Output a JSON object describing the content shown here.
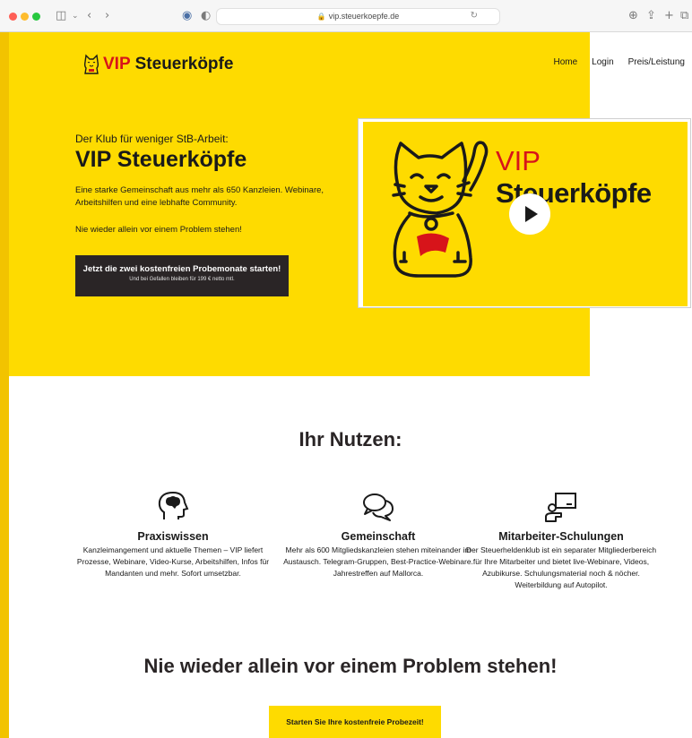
{
  "browser": {
    "url": "vip.steuerkoepfe.de",
    "icons": [
      "sidebar-icon",
      "back-icon",
      "forward-icon",
      "extension-icon",
      "shield-icon",
      "lock-icon",
      "reload-icon",
      "download-icon",
      "share-icon",
      "new-tab-icon",
      "tabs-icon"
    ]
  },
  "logo": {
    "vip": "VIP",
    "name": "Steuerköpfe"
  },
  "nav": {
    "items": [
      "Home",
      "Login",
      "Preis/Leistung"
    ]
  },
  "hero": {
    "tagline": "Der Klub für weniger StB-Arbeit:",
    "title": "VIP Steuerköpfe",
    "description": "Eine starke Gemeinschaft aus mehr als 650 Kanzleien. Webinare, Arbeitshilfen und eine lebhafte Community.",
    "subline": "Nie wieder allein vor einem Problem stehen!",
    "cta_line1": "Jetzt die zwei kostenfreien Probemonate starten!",
    "cta_line2": "Und bei Gefallen bleiben für 199 € netto mtl."
  },
  "video": {
    "vip": "VIP",
    "name": "Steuerköpfe"
  },
  "benefits": {
    "title": "Ihr Nutzen:",
    "items": [
      {
        "title": "Praxiswissen",
        "desc": "Kanzleimangement und aktuelle Themen – VIP liefert Prozesse, Webinare, Video-Kurse, Arbeitshilfen, Infos für  Mandanten und mehr. Sofort umsetzbar.",
        "icon": "brain-head-icon"
      },
      {
        "title": "Gemeinschaft",
        "desc": "Mehr als 600 Mitgliedskanzleien stehen miteinander im Austausch. Telegram-Gruppen, Best-Practice-Webinare. Jahrestreffen auf Mallorca.",
        "icon": "chat-bubbles-icon"
      },
      {
        "title": "Mitarbeiter-Schulungen",
        "desc": "Der Steuerheldenklub ist ein separater Mitgliederbereich für Ihre Mitarbeiter und bietet live-Webinare, Videos, Azubikurse. Schulungsmaterial noch & nöcher. Weiterbildung auf Autopilot.",
        "icon": "presentation-icon"
      }
    ]
  },
  "section2": {
    "title": "Nie wieder allein vor einem Problem stehen!",
    "cta": "Starten Sie Ihre kostenfreie Probezeit!"
  },
  "colors": {
    "yellow": "#fedb00",
    "red": "#d7141a",
    "dark": "#2a2526"
  }
}
